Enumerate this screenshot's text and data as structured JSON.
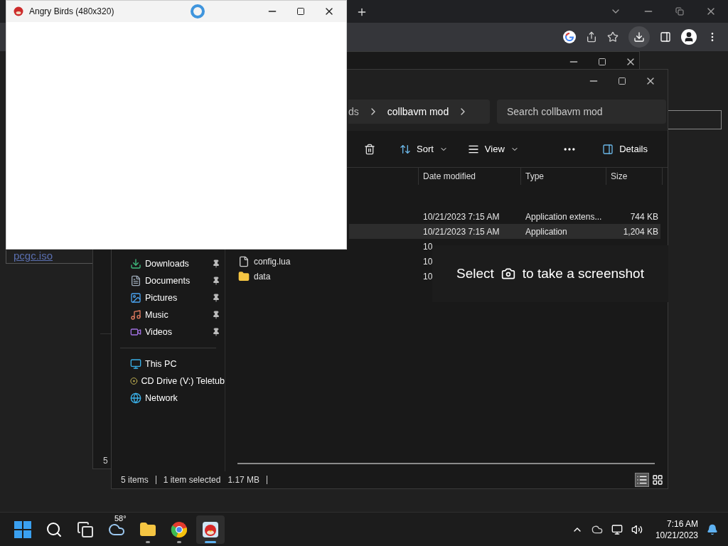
{
  "browser": {
    "page": {
      "link": "pcgc.iso"
    }
  },
  "back_window": {
    "status": "5"
  },
  "explorer": {
    "breadcrumb": [
      "ds",
      "collbavm mod"
    ],
    "search": {
      "placeholder": "Search collbavm mod"
    },
    "toolbar": [
      {
        "kind": "delete"
      },
      {
        "kind": "sort",
        "label": "Sort"
      },
      {
        "kind": "view",
        "label": "View"
      },
      {
        "kind": "more"
      },
      {
        "kind": "details",
        "label": "Details"
      }
    ],
    "columns": [
      "Date modified",
      "Type",
      "Size"
    ],
    "rows": [
      {
        "date": "10/21/2023 7:15 AM",
        "type": "Application extens...",
        "size": "744 KB",
        "selected": false
      },
      {
        "date": "10/21/2023 7:15 AM",
        "type": "Application",
        "size": "1,204 KB",
        "selected": true
      },
      {
        "date": "10",
        "selected": false
      },
      {
        "kind": "file",
        "name": "config.lua",
        "date": "10",
        "selected": false
      },
      {
        "kind": "folder",
        "name": "data",
        "date": "10",
        "selected": false
      }
    ],
    "sidebar": [
      {
        "kind": "downloads",
        "label": "Downloads",
        "pinned": true
      },
      {
        "kind": "documents",
        "label": "Documents",
        "pinned": true
      },
      {
        "kind": "pictures",
        "label": "Pictures",
        "pinned": true
      },
      {
        "kind": "music",
        "label": "Music",
        "pinned": true
      },
      {
        "kind": "videos",
        "label": "Videos",
        "pinned": true
      },
      {
        "kind": "divider"
      },
      {
        "kind": "pc",
        "label": "This PC",
        "pinned": false
      },
      {
        "kind": "drive",
        "label": "CD Drive (V:) Teletub",
        "pinned": false
      },
      {
        "kind": "network",
        "label": "Network",
        "pinned": false
      }
    ],
    "status": [
      "5 items",
      "1 item selected",
      "1.17 MB"
    ],
    "view_modes": [
      {
        "kind": "details",
        "selected": true
      },
      {
        "kind": "tiles",
        "selected": false
      }
    ]
  },
  "game_window": {
    "title": "Angry Birds (480x320)"
  },
  "snip_toast": {
    "before": "Select",
    "after": "to take a screenshot"
  },
  "taskbar": {
    "apps": [
      {
        "kind": "start",
        "running": false,
        "selected": false
      },
      {
        "kind": "search",
        "running": false,
        "selected": false
      },
      {
        "kind": "taskview",
        "running": false,
        "selected": false
      },
      {
        "kind": "weather",
        "badge": "58°",
        "running": false,
        "selected": false
      },
      {
        "kind": "explorer",
        "running": true,
        "selected": false
      },
      {
        "kind": "chrome",
        "running": true,
        "selected": false
      },
      {
        "kind": "game",
        "running": true,
        "selected": true
      }
    ],
    "time": "7:16 AM",
    "date": "10/21/2023"
  }
}
